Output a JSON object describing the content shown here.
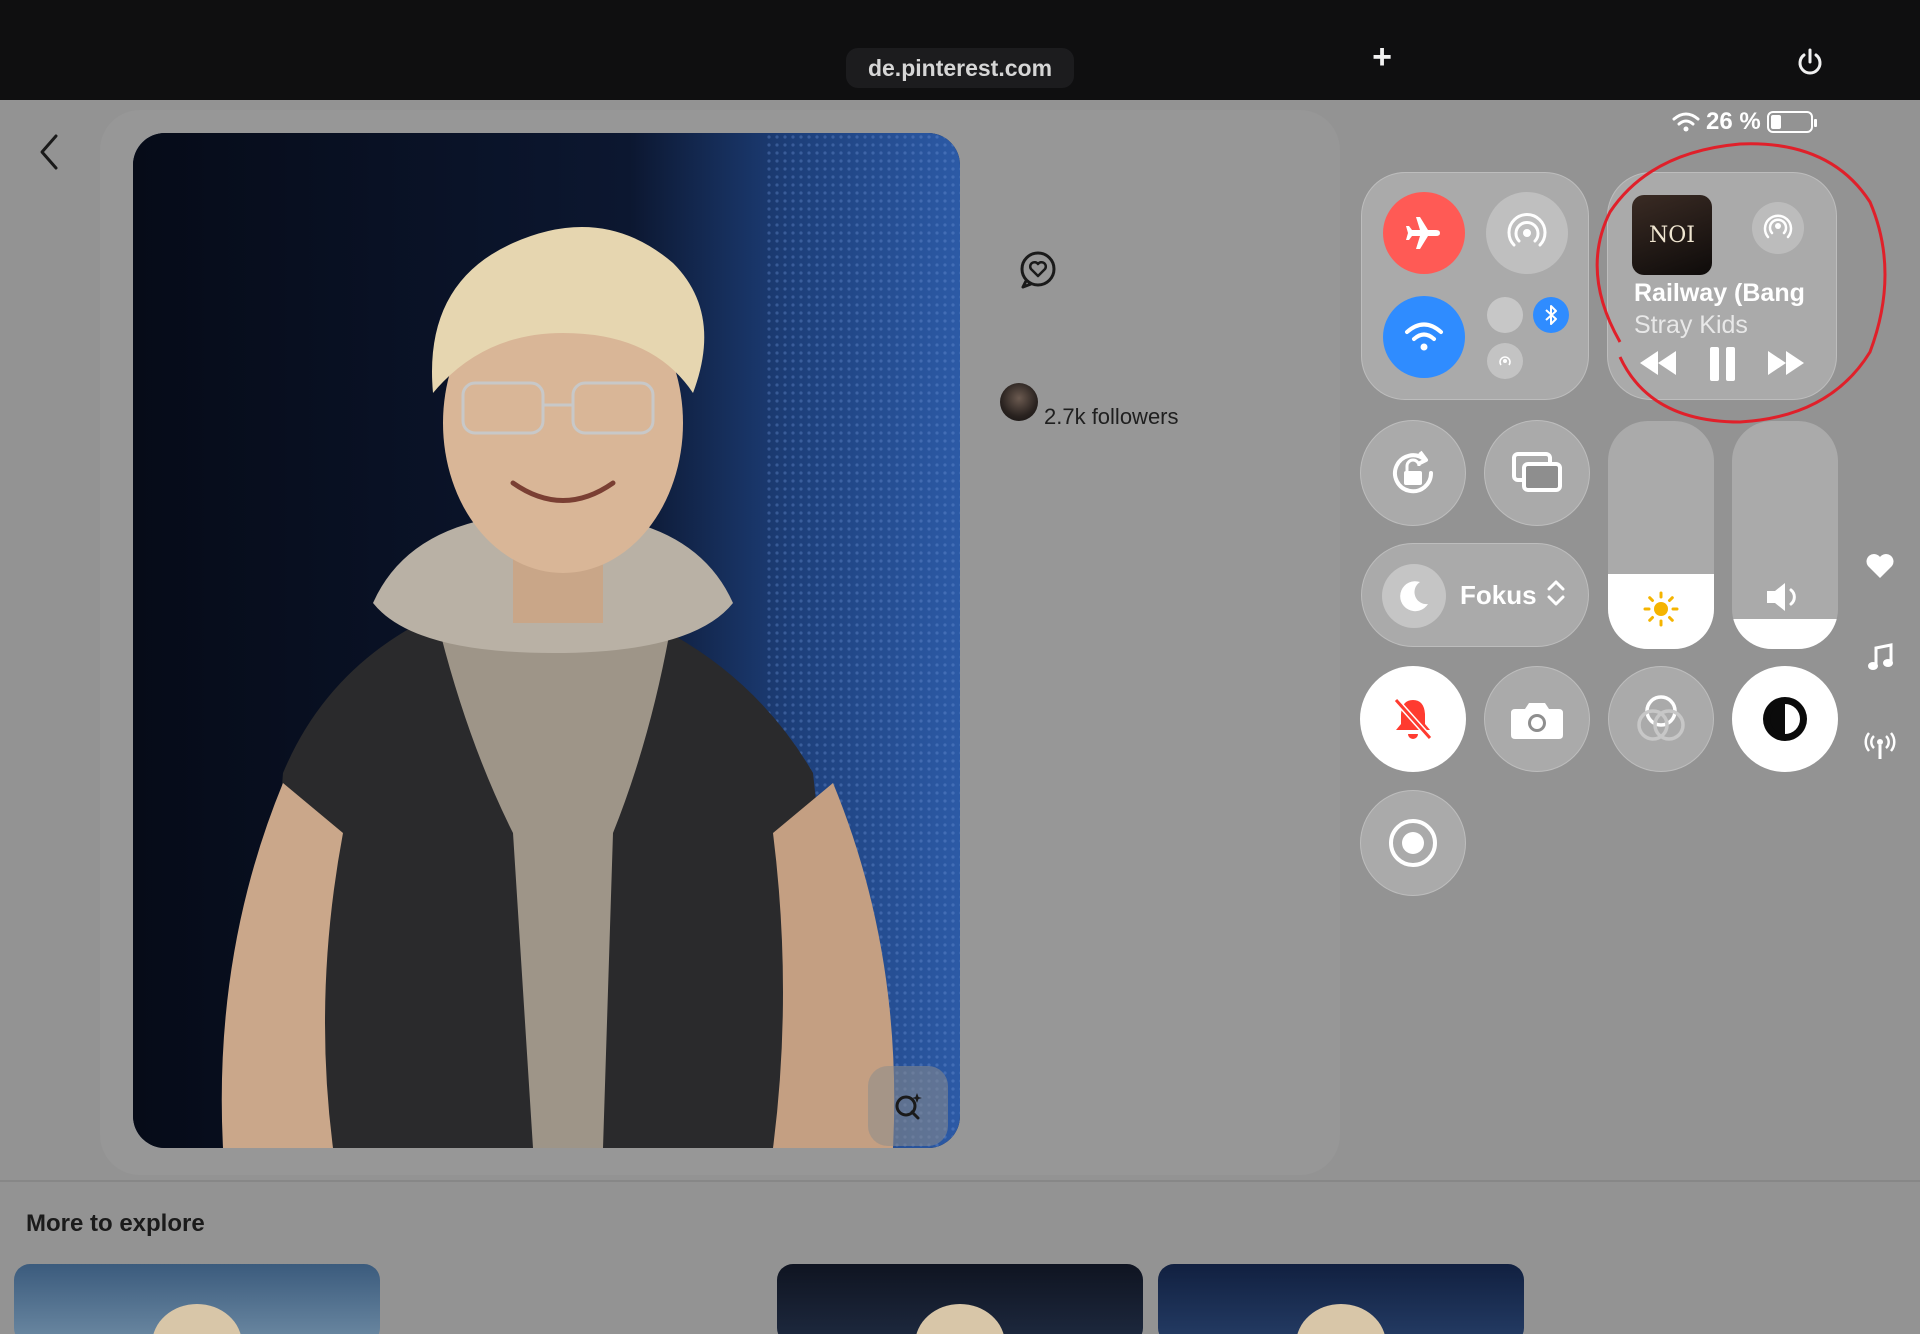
{
  "browser": {
    "url": "de.pinterest.com",
    "new_tab_icon": "plus-icon",
    "power_icon": "power-icon"
  },
  "status_bar": {
    "battery_text": "26 %",
    "battery_level": 0.26,
    "wifi_icon": "wifi-icon"
  },
  "pin": {
    "followers": "2.7k followers",
    "back_icon": "chevron-left-icon",
    "chat_icon": "chat-heart-icon",
    "lens_icon": "visual-search-icon"
  },
  "explore": {
    "title": "More to explore"
  },
  "control_center": {
    "now_playing": {
      "song": "Railway (Bang Chan)",
      "artist": "Stray Kids",
      "album_art_text": "NOI"
    },
    "focus": {
      "label": "Fokus"
    },
    "brightness_level": 0.33,
    "volume_level": 0.13,
    "accent_blue": "#2f8cff",
    "accent_red": "#ff3b30",
    "airplane_color": "#ff5a55"
  }
}
